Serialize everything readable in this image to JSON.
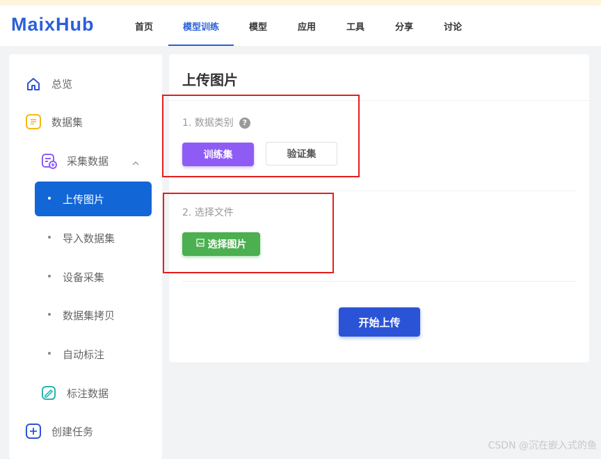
{
  "header": {
    "logo": "MaixHub",
    "nav": [
      "首页",
      "模型训练",
      "模型",
      "应用",
      "工具",
      "分享",
      "讨论"
    ],
    "active_nav": "模型训练"
  },
  "sidebar": {
    "overview": "总览",
    "dataset": "数据集",
    "collect": "采集数据",
    "sub": [
      "上传图片",
      "导入数据集",
      "设备采集",
      "数据集拷贝",
      "自动标注"
    ],
    "label_data": "标注数据",
    "create_task": "创建任务"
  },
  "main": {
    "title": "上传图片",
    "section1": "1. 数据类别",
    "help": "?",
    "train_btn": "训练集",
    "val_btn": "验证集",
    "section2": "2. 选择文件",
    "pick_btn": "选择图片",
    "upload_btn": "开始上传"
  },
  "watermark": "CSDN @沉在嵌入式的鱼",
  "colors": {
    "brand": "#2b5fd9",
    "active_item": "#1366d6",
    "train": "#8e5cf5",
    "pick": "#4caf50",
    "upload": "#2b53d6",
    "annotation": "#e51c1c"
  },
  "icons": {
    "overview": "home-icon",
    "dataset": "document-icon",
    "collect": "add-file-icon",
    "label_data": "edit-icon",
    "create_task": "plus-icon",
    "help": "question-icon",
    "pick": "image-icon",
    "collapse": "chevron-up-icon"
  }
}
